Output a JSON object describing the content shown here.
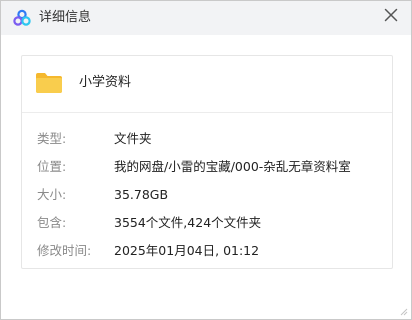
{
  "window": {
    "title": "详细信息",
    "icon": "baidu-netdisk-cloud-icon",
    "close_icon": "close-icon"
  },
  "item": {
    "name": "小学资料",
    "icon": "folder-icon",
    "icon_color": "#f5c23a"
  },
  "details": [
    {
      "label": "类型:",
      "value": "文件夹"
    },
    {
      "label": "位置:",
      "value": "我的网盘/小雷的宝藏/000-杂乱无章资料室"
    },
    {
      "label": "大小:",
      "value": "35.78GB"
    },
    {
      "label": "包含:",
      "value": "3554个文件,424个文件夹"
    },
    {
      "label": "修改时间:",
      "value": "2025年01月04日, 01:12"
    }
  ],
  "colors": {
    "titlebar_bg": "#f2f3f5",
    "label": "#8a8a8a",
    "value": "#222222",
    "brand_blue": "#2f7bf5",
    "brand_purple": "#7b5cf0",
    "brand_cyan": "#2ec7f0"
  }
}
